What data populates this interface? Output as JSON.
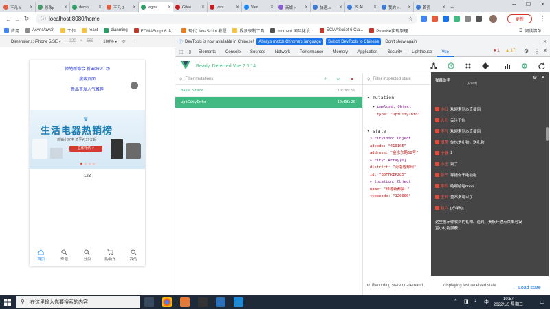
{
  "browser": {
    "tabs": [
      {
        "title": "不凡 k",
        "color": "#e35d3e"
      },
      {
        "title": "修改p",
        "color": "#4a9b6a"
      },
      {
        "title": "demo",
        "color": "#2e9e66"
      },
      {
        "title": "不凡 J",
        "color": "#e35d3e"
      },
      {
        "title": "legou",
        "color": "#2e9e66",
        "active": true
      },
      {
        "title": "Gitee",
        "color": "#c71d23"
      },
      {
        "title": "vant",
        "color": "#c71d23"
      },
      {
        "title": "Vant",
        "color": "#1989fa"
      },
      {
        "title": "商城 >",
        "color": "#8a5cd6"
      },
      {
        "title": "快速上",
        "color": "#3c7bd6"
      },
      {
        "title": "JS AI",
        "color": "#3c7bd6"
      },
      {
        "title": "我的 >",
        "color": "#3c7bd6"
      },
      {
        "title": "首页",
        "color": "#3c7bd6"
      }
    ],
    "new_tab": "+",
    "url": "localhost:8080/home",
    "update_label": "更新",
    "reading_list": "阅读清单",
    "bookmarks": [
      {
        "label": "应用",
        "color": "#4285f4"
      },
      {
        "label": "Async/await",
        "color": "#8c8c8c"
      },
      {
        "label": "工作",
        "color": "#f5c242"
      },
      {
        "label": "react",
        "color": "#f5c242"
      },
      {
        "label": "dianming",
        "color": "#2e9e66"
      },
      {
        "label": "ECMAScript 6 入...",
        "color": "#c0392b"
      },
      {
        "label": "现代 JavaScript 教程",
        "color": "#e67e22"
      },
      {
        "label": "视频录制工具",
        "color": "#f5c242"
      },
      {
        "label": "moment 国际化设...",
        "color": "#555555"
      },
      {
        "label": "ECMAScript 6 Cla...",
        "color": "#c0392b"
      },
      {
        "label": "Promise实现原理...",
        "color": "#c0392b"
      }
    ]
  },
  "device_toolbar": {
    "device": "Dimensions: iPhone 5/SE ▾",
    "width": "320",
    "times": "×",
    "height": "568",
    "zoom": "100% ▾"
  },
  "phone": {
    "links": [
      "师地新都会 新田360广场",
      "搜索页面",
      "新品首发人气推荐"
    ],
    "banner": {
      "title": "生活电器热销榜",
      "subtitle": "热销小家电 低至¥129元起",
      "cta": "立即抢购 >"
    },
    "counter": "123",
    "tabbar": [
      {
        "label": "首页",
        "icon": "home-icon",
        "active": true
      },
      {
        "label": "专题",
        "icon": "search-icon"
      },
      {
        "label": "分类",
        "icon": "search-icon"
      },
      {
        "label": "购物车",
        "icon": "cart-icon"
      },
      {
        "label": "我的",
        "icon": "search-icon"
      }
    ]
  },
  "devtools": {
    "info_text": "DevTools is now available in Chinese!",
    "btn_match": "Always match Chrome's language",
    "btn_switch": "Switch DevTools to Chinese",
    "btn_dont": "Don't show again",
    "tabs": [
      "Elements",
      "Console",
      "Sources",
      "Network",
      "Performance",
      "Memory",
      "Application",
      "Security",
      "Lighthouse",
      "Vue"
    ],
    "active_tab": "Vue",
    "errors": "1",
    "warnings": "17",
    "vue_status": "Ready. Detected Vue 2.6.14.",
    "filter_mutations": "Filter mutations",
    "mutations": [
      {
        "name": "Base State",
        "time": "10:38:59"
      },
      {
        "name": "uptCityInfo",
        "time": "10:56:20"
      }
    ],
    "filter_state": "Filter inspected state",
    "mutation_section": "mutation",
    "payload_line": "payload: Object",
    "type_line": "type: \"uptCityInfo\"",
    "state_section": "state",
    "state_lines": [
      "▾ cityInfo: Object",
      "    adcode: \"410105\"",
      "    address: \"金水东路68号\"",
      "  ▸ city: Array[0]",
      "    district: \"河南省郑州\"",
      "    id: \"B0FFKIP285\"",
      "  ▸ location: Object",
      "    name: \"绿地新都会·\"",
      "    typecode: \"120000\""
    ],
    "recording": "Recording state on-demand...",
    "displaying": "displaying last received state",
    "load_state": "Load state"
  },
  "live_panel": {
    "title": "弹幕助手",
    "subtitle": "(Root)",
    "messages": [
      {
        "user": "小红",
        "text": "欢迎来到本直播间"
      },
      {
        "user": "大力",
        "text": "关注了你"
      },
      {
        "user": "不凡",
        "text": "欢迎来到本直播间"
      },
      {
        "user": "浪花",
        "text": "你也是礼物，送礼物"
      },
      {
        "user": "宁静",
        "text": "1"
      },
      {
        "user": "小王",
        "text": "到了"
      },
      {
        "user": "张三",
        "text": "导播你干啥啦啦"
      },
      {
        "user": "李四",
        "text": "哈啊哈哈6666"
      },
      {
        "user": "王五",
        "text": "差不多可以了"
      },
      {
        "user": "赵六",
        "text": "[好样的]"
      }
    ],
    "note": "这里展示你收到的礼物、道具、贵族开通点菜单可设置小礼物屏蔽"
  },
  "taskbar": {
    "search_placeholder": "在这里输入你要搜索的内容",
    "time": "10:57",
    "date": "2022/1/5 星期三",
    "lang": "中"
  }
}
